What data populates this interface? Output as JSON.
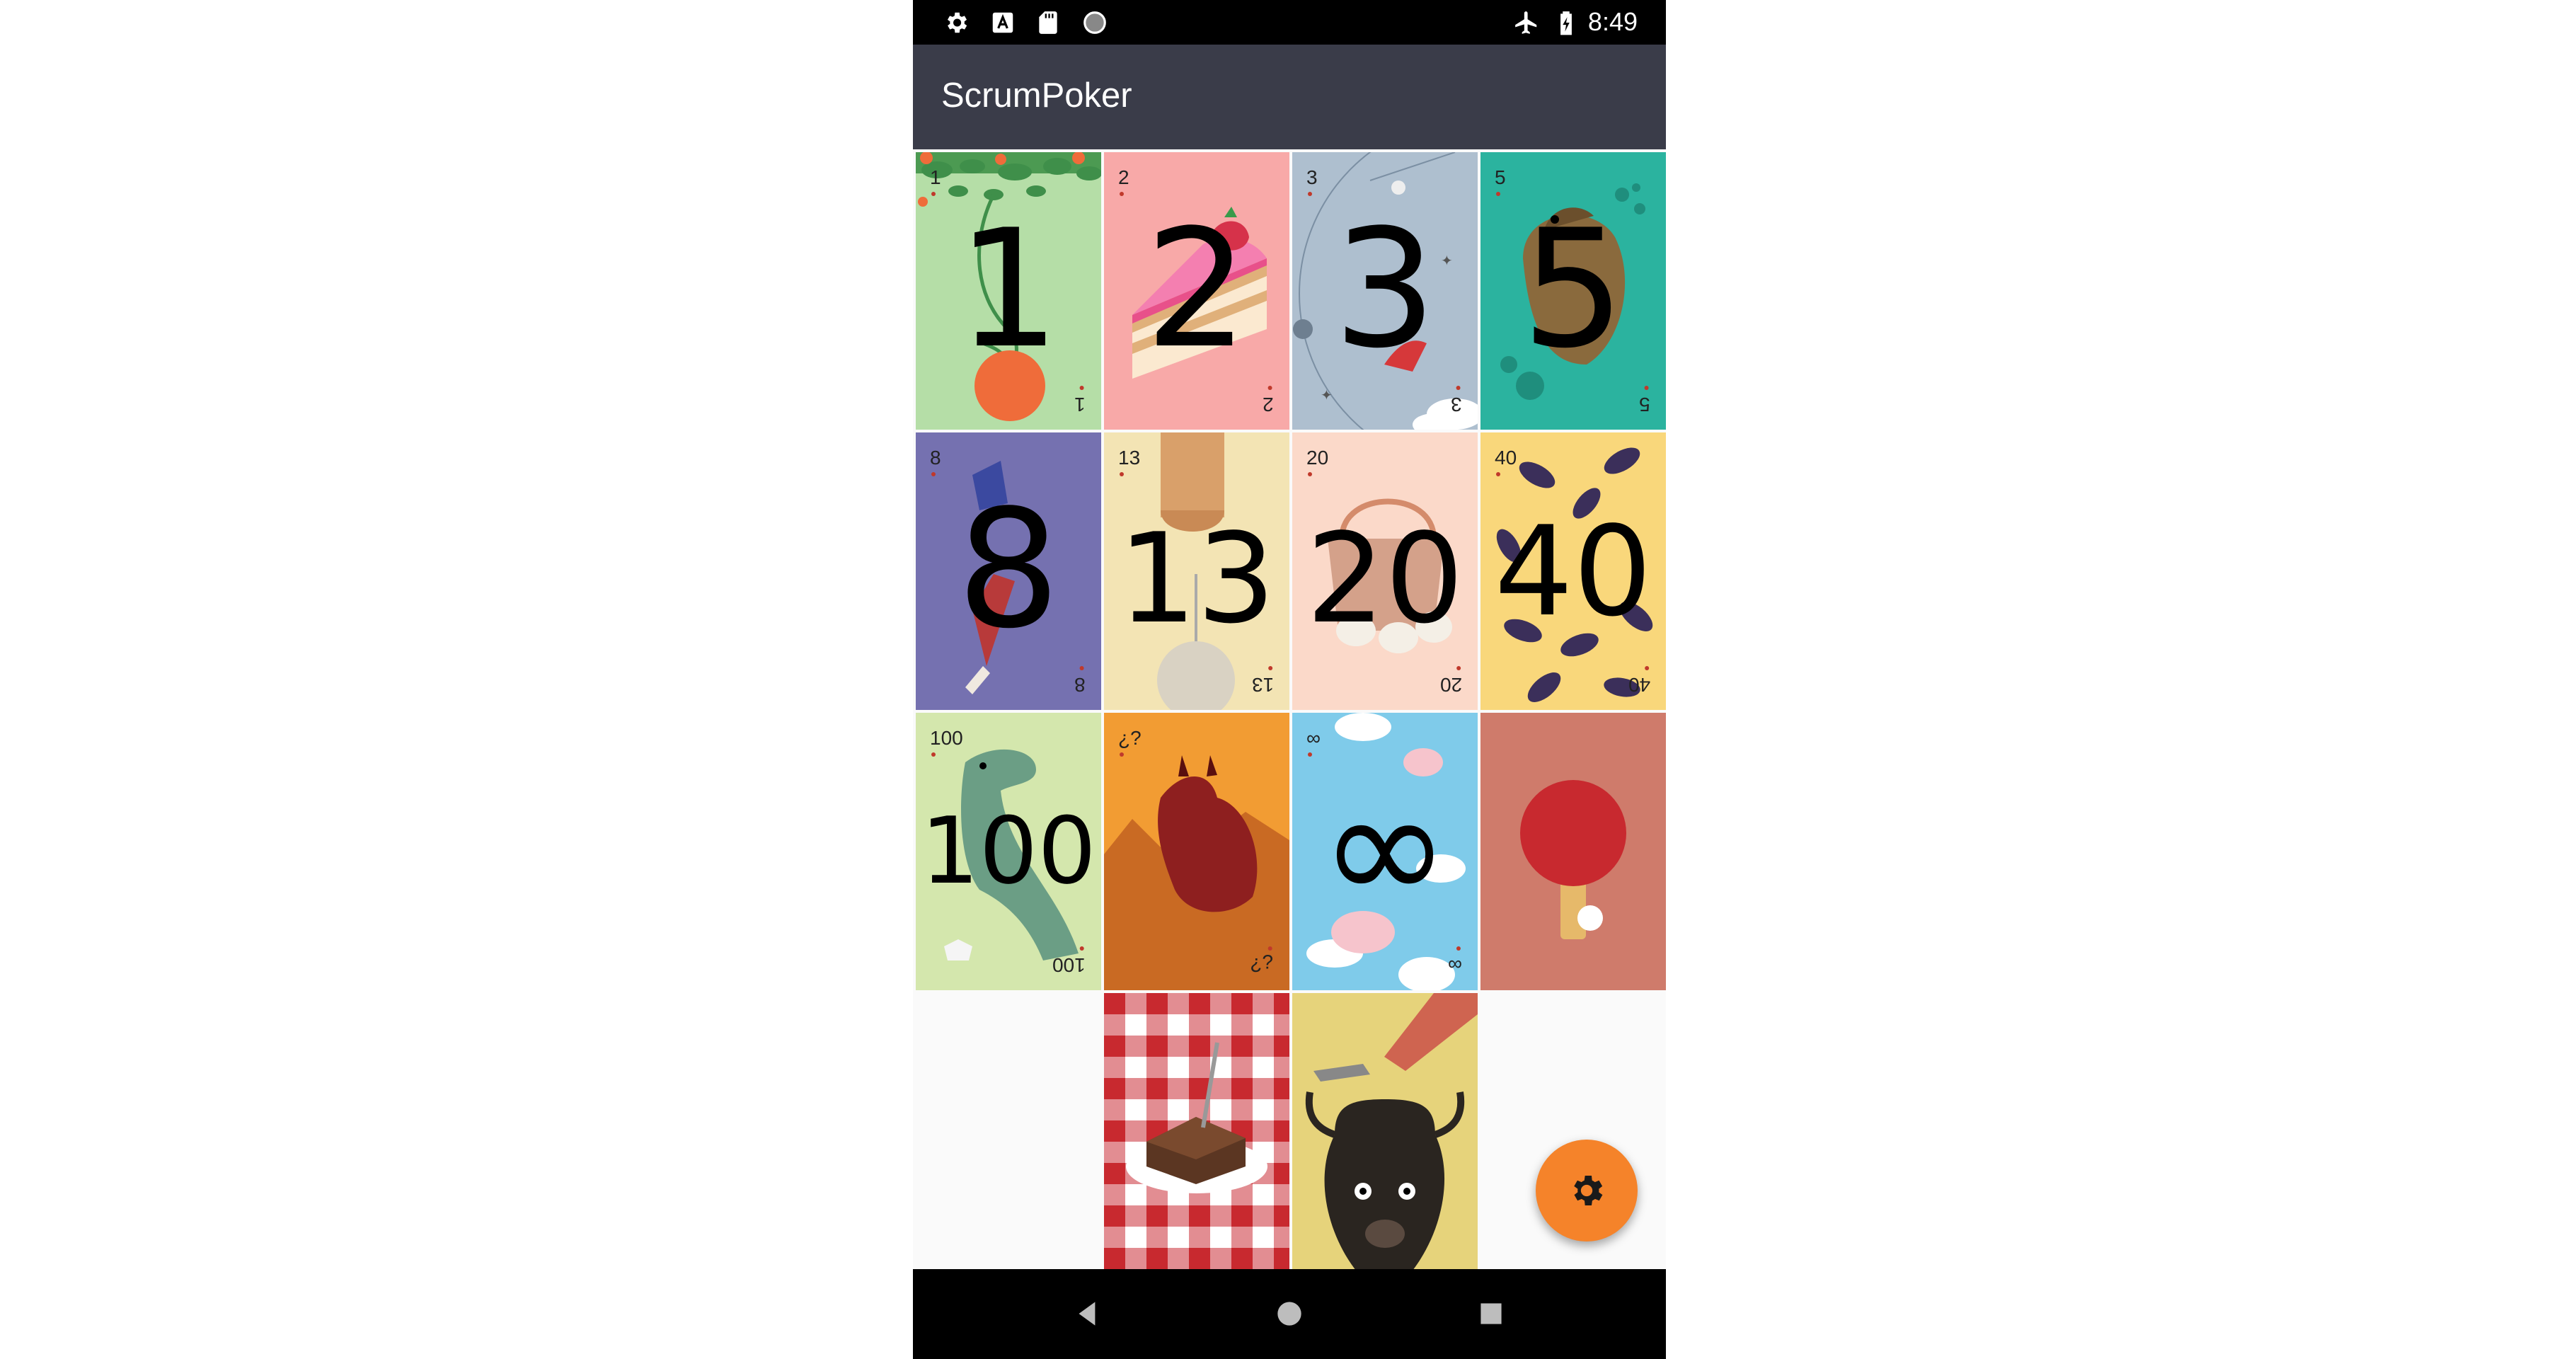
{
  "status_bar": {
    "time": "8:49",
    "left_icons": [
      "settings-icon",
      "text-a-icon",
      "sd-card-icon",
      "record-icon"
    ],
    "right_icons": [
      "airplane-mode-icon",
      "battery-charging-icon"
    ]
  },
  "app_bar": {
    "title": "ScrumPoker"
  },
  "cards": [
    {
      "value": "1",
      "big": "1",
      "bg": "#b5dea7"
    },
    {
      "value": "2",
      "big": "2",
      "bg": "#f8a9a8"
    },
    {
      "value": "3",
      "big": "3",
      "bg": "#aebfcf"
    },
    {
      "value": "5",
      "big": "5",
      "bg": "#2bb39f"
    },
    {
      "value": "8",
      "big": "8",
      "bg": "#7571b0"
    },
    {
      "value": "13",
      "big": "13",
      "bg": "#f3e4b4"
    },
    {
      "value": "20",
      "big": "20",
      "bg": "#fbd9c9"
    },
    {
      "value": "40",
      "big": "40",
      "bg": "#f9d77b"
    },
    {
      "value": "100",
      "big": "100",
      "bg": "#d4e7ad"
    },
    {
      "value": "¿?",
      "big": "",
      "bg": "#f29c33"
    },
    {
      "value": "∞",
      "big": "∞",
      "bg": "#7fcbea"
    },
    {
      "value": "",
      "big": "",
      "bg": "#cf7b6b"
    },
    {
      "value": "",
      "big": "",
      "bg": "#ffffff"
    },
    {
      "value": "",
      "big": "",
      "bg": "#e6d37b"
    }
  ],
  "card_icons": [
    "tree-icon",
    "cake-icon",
    "rocket-icon",
    "platypus-icon",
    "arm-icon",
    "cat-paw-icon",
    "basket-icon",
    "eggplant-icon",
    "dinosaur-icon",
    "dragon-icon",
    "flying-pig-icon",
    "ping-pong-icon",
    "brownie-icon",
    "yak-icon"
  ],
  "fab": {
    "icon": "settings-icon",
    "color": "#f5832a"
  },
  "nav": {
    "icons": [
      "back-icon",
      "home-icon",
      "recents-icon"
    ]
  }
}
